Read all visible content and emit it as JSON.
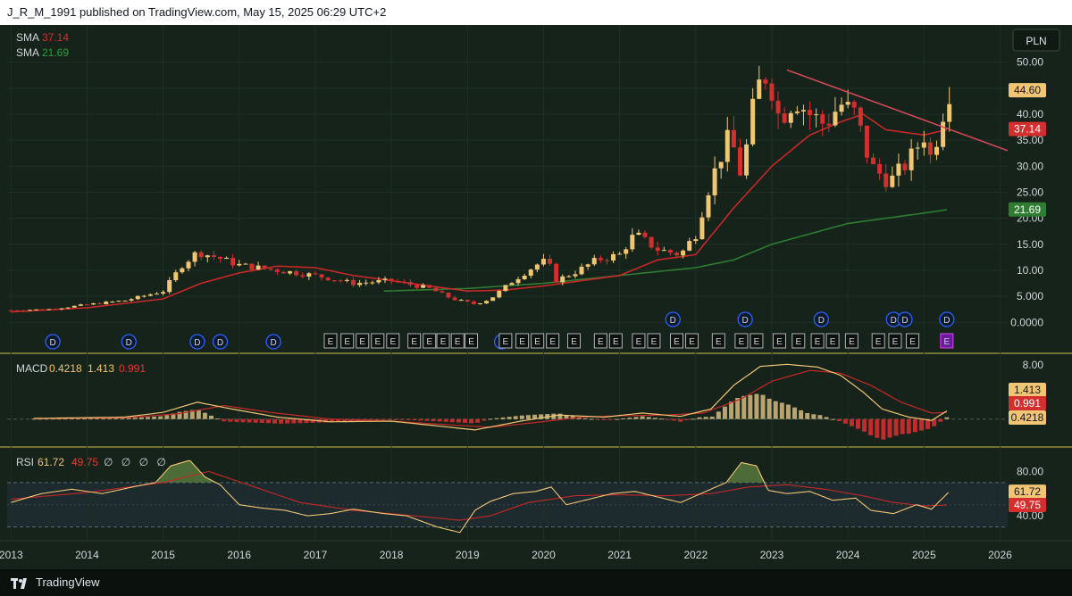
{
  "header": {
    "text": "J_R_M_1991 published on TradingView.com, May 15, 2025 06:29 UTC+2"
  },
  "footer": {
    "brand": "TradingView"
  },
  "currency": "PLN",
  "legend": {
    "sma1": {
      "name": "SMA",
      "value": "37.14",
      "color": "#d32f2f"
    },
    "sma2": {
      "name": "SMA",
      "value": "21.69",
      "color": "#2e7d32"
    },
    "macd": {
      "name": "MACD",
      "v1": "0.4218",
      "v2": "1.413",
      "v3": "0.991"
    },
    "rsi": {
      "name": "RSI",
      "v1": "61.72",
      "v2": "49.75",
      "extra": "∅ ∅ ∅ ∅"
    }
  },
  "chart_data": {
    "type": "candlestick",
    "price_axis": [
      "50.00",
      "45.00",
      "40.00",
      "35.00",
      "30.00",
      "25.00",
      "20.00",
      "15.00",
      "10.00",
      "5.000",
      "0.0000"
    ],
    "price_ticks": [
      50,
      45,
      40,
      35,
      30,
      25,
      20,
      15,
      10,
      5,
      0
    ],
    "price_labels": [
      {
        "text": "44.60",
        "value": 44.6,
        "bg": "#f0c674",
        "fg": "#131722"
      },
      {
        "text": "37.14",
        "value": 37.14,
        "bg": "#d32f2f",
        "fg": "#ffffff"
      },
      {
        "text": "21.69",
        "value": 21.69,
        "bg": "#2e7d32",
        "fg": "#ffffff"
      }
    ],
    "x_axis": [
      "2013",
      "2014",
      "2015",
      "2016",
      "2017",
      "2018",
      "2019",
      "2020",
      "2021",
      "2022",
      "2023",
      "2024",
      "2025",
      "2026"
    ],
    "x_ticks": [
      2013,
      2014,
      2015,
      2016,
      2017,
      2018,
      2019,
      2020,
      2021,
      2022,
      2023,
      2024,
      2025,
      2026
    ],
    "x_range": [
      2012.95,
      2026.1
    ],
    "price_range": [
      -1.5,
      52
    ],
    "close_keyframes": [
      [
        2013.0,
        2.3
      ],
      [
        2013.5,
        2.5
      ],
      [
        2014.0,
        3.4
      ],
      [
        2014.5,
        4.2
      ],
      [
        2015.0,
        6.0
      ],
      [
        2015.25,
        11.0
      ],
      [
        2015.45,
        13.5
      ],
      [
        2015.7,
        12.5
      ],
      [
        2016.0,
        11.0
      ],
      [
        2016.5,
        10.0
      ],
      [
        2017.0,
        9.0
      ],
      [
        2017.5,
        7.5
      ],
      [
        2018.0,
        8.0
      ],
      [
        2018.5,
        6.5
      ],
      [
        2018.8,
        4.5
      ],
      [
        2019.1,
        3.5
      ],
      [
        2019.3,
        4.5
      ],
      [
        2019.6,
        8.0
      ],
      [
        2019.9,
        11.0
      ],
      [
        2020.05,
        12.0
      ],
      [
        2020.15,
        8.0
      ],
      [
        2020.4,
        9.5
      ],
      [
        2020.7,
        12.0
      ],
      [
        2021.0,
        13.0
      ],
      [
        2021.2,
        17.0
      ],
      [
        2021.5,
        14.0
      ],
      [
        2021.8,
        13.0
      ],
      [
        2022.0,
        17.0
      ],
      [
        2022.15,
        25.0
      ],
      [
        2022.3,
        31.0
      ],
      [
        2022.45,
        36.0
      ],
      [
        2022.6,
        28.0
      ],
      [
        2022.8,
        45.0
      ],
      [
        2022.95,
        48.0
      ],
      [
        2023.1,
        39.0
      ],
      [
        2023.3,
        43.0
      ],
      [
        2023.5,
        40.0
      ],
      [
        2023.7,
        38.0
      ],
      [
        2023.9,
        42.0
      ],
      [
        2024.1,
        40.0
      ],
      [
        2024.3,
        30.0
      ],
      [
        2024.55,
        27.0
      ],
      [
        2024.8,
        31.0
      ],
      [
        2025.0,
        36.0
      ],
      [
        2025.1,
        31.0
      ],
      [
        2025.22,
        39.0
      ],
      [
        2025.33,
        44.6
      ]
    ],
    "sma_slow_keyframes": [
      [
        2017.9,
        6.0
      ],
      [
        2019.0,
        6.5
      ],
      [
        2020.0,
        7.5
      ],
      [
        2021.0,
        9.0
      ],
      [
        2022.0,
        10.5
      ],
      [
        2022.5,
        12.0
      ],
      [
        2023.0,
        15.0
      ],
      [
        2023.5,
        17.0
      ],
      [
        2024.0,
        19.0
      ],
      [
        2024.5,
        20.0
      ],
      [
        2025.0,
        21.0
      ],
      [
        2025.33,
        21.69
      ]
    ],
    "sma_fast_keyframes": [
      [
        2013.0,
        2.0
      ],
      [
        2014.0,
        2.8
      ],
      [
        2015.0,
        4.5
      ],
      [
        2015.5,
        7.5
      ],
      [
        2016.0,
        9.5
      ],
      [
        2016.5,
        10.8
      ],
      [
        2017.0,
        10.5
      ],
      [
        2017.5,
        9.0
      ],
      [
        2018.0,
        8.0
      ],
      [
        2018.5,
        7.0
      ],
      [
        2019.0,
        6.0
      ],
      [
        2019.5,
        6.2
      ],
      [
        2020.0,
        7.0
      ],
      [
        2021.0,
        9.0
      ],
      [
        2021.5,
        12.0
      ],
      [
        2022.0,
        13.0
      ],
      [
        2022.5,
        22.0
      ],
      [
        2023.0,
        30.0
      ],
      [
        2023.5,
        36.0
      ],
      [
        2023.9,
        38.5
      ],
      [
        2024.2,
        40.0
      ],
      [
        2024.5,
        37.0
      ],
      [
        2025.0,
        36.0
      ],
      [
        2025.33,
        37.14
      ]
    ],
    "trendline": {
      "from": [
        2023.2,
        48.5
      ],
      "to": [
        2026.1,
        33.0
      ]
    },
    "dividend_markers_upper": [
      2021.7,
      2022.65,
      2023.65,
      2024.6,
      2024.75,
      2025.3
    ],
    "dividend_markers_lower": [
      2013.55,
      2014.55,
      2015.45,
      2015.75,
      2016.45,
      2019.45
    ],
    "earnings_markers": [
      2017.2,
      2017.42,
      2017.62,
      2017.82,
      2018.02,
      2018.3,
      2018.5,
      2018.68,
      2018.87,
      2019.05,
      2019.5,
      2019.72,
      2019.92,
      2020.12,
      2020.4,
      2020.75,
      2020.95,
      2021.25,
      2021.45,
      2021.75,
      2021.95,
      2022.3,
      2022.6,
      2022.8,
      2023.1,
      2023.35,
      2023.6,
      2023.8,
      2024.05,
      2024.4,
      2024.62,
      2024.85,
      2025.3
    ],
    "legend_label": "E",
    "dividend_label": "D",
    "macd": {
      "axis": [
        "8.00"
      ],
      "range": [
        -3.2,
        9.2
      ],
      "axis_value": 8,
      "labels": [
        {
          "text": "1.413",
          "value": 1.413,
          "bg": "#f0c674",
          "fg": "#131722"
        },
        {
          "text": "0.991",
          "value": 0.991,
          "bg": "#d32f2f",
          "fg": "#ffffff"
        },
        {
          "text": "0.4218",
          "value": 0.4218,
          "bg": "#f0c674",
          "fg": "#131722"
        }
      ],
      "line_keyframes": [
        [
          2013.3,
          0.1
        ],
        [
          2014.5,
          0.3
        ],
        [
          2015.0,
          1.0
        ],
        [
          2015.45,
          2.5
        ],
        [
          2015.9,
          1.5
        ],
        [
          2016.5,
          0.3
        ],
        [
          2017.2,
          -0.4
        ],
        [
          2018.0,
          -0.3
        ],
        [
          2018.6,
          -1.0
        ],
        [
          2019.1,
          -1.6
        ],
        [
          2019.7,
          -0.3
        ],
        [
          2020.2,
          0.6
        ],
        [
          2020.8,
          0.3
        ],
        [
          2021.3,
          0.9
        ],
        [
          2021.8,
          0.4
        ],
        [
          2022.2,
          1.5
        ],
        [
          2022.5,
          5.0
        ],
        [
          2022.85,
          7.8
        ],
        [
          2023.2,
          8.1
        ],
        [
          2023.6,
          7.7
        ],
        [
          2023.9,
          6.5
        ],
        [
          2024.2,
          4.0
        ],
        [
          2024.45,
          1.5
        ],
        [
          2024.8,
          0.3
        ],
        [
          2025.1,
          -0.2
        ],
        [
          2025.33,
          1.413
        ]
      ],
      "signal_keyframes": [
        [
          2013.3,
          0.05
        ],
        [
          2014.5,
          0.2
        ],
        [
          2015.2,
          0.8
        ],
        [
          2015.8,
          2.0
        ],
        [
          2016.4,
          1.0
        ],
        [
          2017.2,
          0.0
        ],
        [
          2018.0,
          -0.3
        ],
        [
          2018.7,
          -0.8
        ],
        [
          2019.3,
          -1.2
        ],
        [
          2019.9,
          -0.5
        ],
        [
          2020.5,
          0.3
        ],
        [
          2021.0,
          0.5
        ],
        [
          2021.6,
          0.6
        ],
        [
          2022.1,
          0.9
        ],
        [
          2022.6,
          3.0
        ],
        [
          2023.0,
          5.6
        ],
        [
          2023.5,
          7.2
        ],
        [
          2023.9,
          6.8
        ],
        [
          2024.3,
          5.0
        ],
        [
          2024.7,
          2.5
        ],
        [
          2025.1,
          0.9
        ],
        [
          2025.33,
          0.991
        ]
      ]
    },
    "rsi": {
      "axis": [
        "80.00",
        "40.00"
      ],
      "axis_values": [
        80,
        40
      ],
      "range": [
        20,
        98
      ],
      "bands": [
        70,
        30
      ],
      "labels": [
        {
          "text": "61.72",
          "value": 61.72,
          "bg": "#f0c674",
          "fg": "#131722"
        },
        {
          "text": "49.75",
          "value": 49.75,
          "bg": "#d32f2f",
          "fg": "#ffffff"
        }
      ],
      "line_keyframes": [
        [
          2013.0,
          52
        ],
        [
          2013.4,
          60
        ],
        [
          2013.8,
          64
        ],
        [
          2014.2,
          60
        ],
        [
          2014.6,
          66
        ],
        [
          2014.9,
          70
        ],
        [
          2015.1,
          85
        ],
        [
          2015.35,
          90
        ],
        [
          2015.55,
          75
        ],
        [
          2015.75,
          68
        ],
        [
          2016.0,
          50
        ],
        [
          2016.3,
          47
        ],
        [
          2016.6,
          45
        ],
        [
          2016.9,
          40
        ],
        [
          2017.2,
          42
        ],
        [
          2017.5,
          46
        ],
        [
          2017.9,
          42
        ],
        [
          2018.2,
          40
        ],
        [
          2018.6,
          30
        ],
        [
          2018.9,
          25
        ],
        [
          2019.1,
          45
        ],
        [
          2019.3,
          53
        ],
        [
          2019.6,
          60
        ],
        [
          2019.9,
          62
        ],
        [
          2020.1,
          66
        ],
        [
          2020.3,
          50
        ],
        [
          2020.6,
          55
        ],
        [
          2020.9,
          60
        ],
        [
          2021.2,
          62
        ],
        [
          2021.5,
          57
        ],
        [
          2021.8,
          52
        ],
        [
          2022.1,
          61
        ],
        [
          2022.4,
          70
        ],
        [
          2022.6,
          88
        ],
        [
          2022.8,
          85
        ],
        [
          2022.95,
          63
        ],
        [
          2023.2,
          60
        ],
        [
          2023.5,
          62
        ],
        [
          2023.8,
          54
        ],
        [
          2024.1,
          56
        ],
        [
          2024.3,
          45
        ],
        [
          2024.6,
          42
        ],
        [
          2024.9,
          50
        ],
        [
          2025.1,
          46
        ],
        [
          2025.33,
          61.72
        ]
      ],
      "signal_keyframes": [
        [
          2013.0,
          55
        ],
        [
          2014.0,
          61
        ],
        [
          2015.0,
          70
        ],
        [
          2015.6,
          80
        ],
        [
          2016.2,
          66
        ],
        [
          2016.8,
          52
        ],
        [
          2017.5,
          45
        ],
        [
          2018.3,
          40
        ],
        [
          2018.9,
          36
        ],
        [
          2019.3,
          40
        ],
        [
          2019.8,
          52
        ],
        [
          2020.4,
          58
        ],
        [
          2021.0,
          59
        ],
        [
          2021.6,
          58
        ],
        [
          2022.2,
          60
        ],
        [
          2022.7,
          66
        ],
        [
          2023.2,
          68
        ],
        [
          2023.7,
          64
        ],
        [
          2024.2,
          58
        ],
        [
          2024.6,
          52
        ],
        [
          2025.0,
          49
        ],
        [
          2025.33,
          49.75
        ]
      ]
    }
  }
}
